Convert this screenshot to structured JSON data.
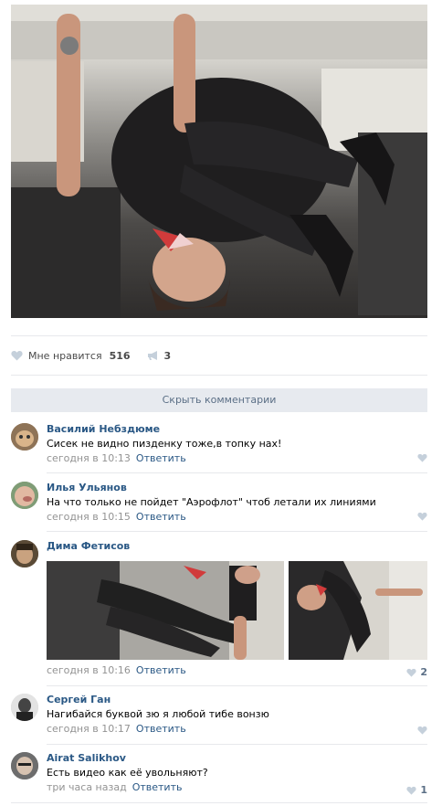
{
  "post": {
    "likes_label": "Мне нравится",
    "likes_count": "516",
    "shares_count": "3"
  },
  "hide_comments_label": "Скрыть комментарии",
  "colors": {
    "link": "#2a5885",
    "meta": "#939393",
    "divider": "#e7e8ec",
    "hide_bg": "#e7eaef",
    "icon": "#c5d0db"
  },
  "comments": [
    {
      "author": "Василий Небздюме",
      "text": "Сисек не видно пизденку тоже,в топку нах!",
      "time": "сегодня в 10:13",
      "reply": "Ответить",
      "likes": ""
    },
    {
      "author": "Илья Ульянов",
      "text": "На что только не пойдет \"Аэрофлот\" чтоб летали их линиями",
      "time": "сегодня в 10:15",
      "reply": "Ответить",
      "likes": ""
    },
    {
      "author": "Дима Фетисов",
      "text": "",
      "time": "сегодня в 10:16",
      "reply": "Ответить",
      "likes": "2"
    },
    {
      "author": "Сергей Ган",
      "text": "Нагибайся буквой зю я любой тибе вонзю",
      "time": "сегодня в 10:17",
      "reply": "Ответить",
      "likes": ""
    },
    {
      "author": "Airat Salikhov",
      "text": "Есть видео как её увольняют?",
      "time": "три часа назад",
      "reply": "Ответить",
      "likes": "1"
    }
  ],
  "icons": {
    "like": "heart-icon",
    "share": "megaphone-icon"
  }
}
